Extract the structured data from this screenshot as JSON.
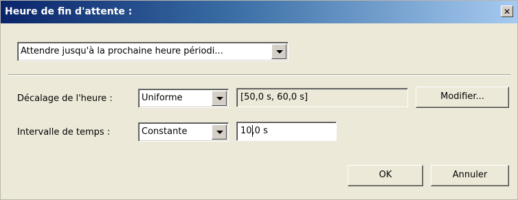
{
  "dialog": {
    "title": "Heure de fin d'attente :",
    "close_glyph": "✕"
  },
  "mode_select": {
    "value": "Attendre jusqu'à la prochaine heure périodi..."
  },
  "offset": {
    "label": "Décalage de l'heure :",
    "distribution": "Uniforme",
    "range_value": "[50,0 s, 60,0 s]",
    "modify_label": "Modifier..."
  },
  "interval": {
    "label": "Intervalle de temps :",
    "distribution": "Constante",
    "value": "10,0 s"
  },
  "buttons": {
    "ok": "OK",
    "cancel": "Annuler"
  }
}
